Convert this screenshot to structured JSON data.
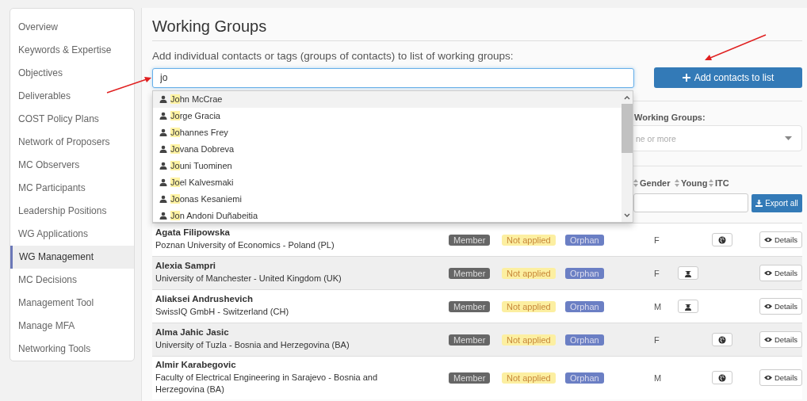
{
  "sidebar": {
    "items": [
      {
        "label": "Overview",
        "selected": false
      },
      {
        "label": "Keywords & Expertise",
        "selected": false
      },
      {
        "label": "Objectives",
        "selected": false
      },
      {
        "label": "Deliverables",
        "selected": false
      },
      {
        "label": "COST Policy Plans",
        "selected": false
      },
      {
        "label": "Network of Proposers",
        "selected": false
      },
      {
        "label": "MC Observers",
        "selected": false
      },
      {
        "label": "MC Participants",
        "selected": false
      },
      {
        "label": "Leadership Positions",
        "selected": false
      },
      {
        "label": "WG Applications",
        "selected": false
      },
      {
        "label": "WG Management",
        "selected": true
      },
      {
        "label": "MC Decisions",
        "selected": false
      },
      {
        "label": "Management Tool",
        "selected": false
      },
      {
        "label": "Manage MFA",
        "selected": false
      },
      {
        "label": "Networking Tools",
        "selected": false
      }
    ]
  },
  "page": {
    "title": "Working Groups",
    "add_label": "Add individual contacts or tags (groups of contacts) to list of working groups:",
    "search": {
      "value": "jo"
    },
    "add_button": "Add contacts to list"
  },
  "suggestions": [
    {
      "match": "Jo",
      "rest": "hn McCrae",
      "selected": true
    },
    {
      "match": "Jo",
      "rest": "rge Gracia",
      "selected": false
    },
    {
      "match": "Jo",
      "rest": "hannes Frey",
      "selected": false
    },
    {
      "match": "Jo",
      "rest": "vana Dobreva",
      "selected": false
    },
    {
      "match": "Jo",
      "rest": "uni Tuominen",
      "selected": false
    },
    {
      "match": "Jo",
      "rest": "el Kalvesmaki",
      "selected": false
    },
    {
      "match": "Jo",
      "rest": "onas Kesaniemi",
      "selected": false
    },
    {
      "match": "Jo",
      "rest": "n Andoni Duñabeitia",
      "selected": false
    }
  ],
  "filter": {
    "label": "Working Groups:",
    "placeholder": "ne or more"
  },
  "table": {
    "columns": [
      "Gender",
      "Young",
      "ITC"
    ],
    "export_button": "Export all",
    "rows": [
      {
        "name": "Agata Filipowska",
        "affiliation": "Poznan University of Economics - Poland (PL)",
        "role": "Member",
        "application": "Not applied",
        "status": "Orphan",
        "gender": "F",
        "young": false,
        "itc": true,
        "details": "Details"
      },
      {
        "name": "Alexia Sampri",
        "affiliation": "University of Manchester - United Kingdom (UK)",
        "role": "Member",
        "application": "Not applied",
        "status": "Orphan",
        "gender": "F",
        "young": true,
        "itc": false,
        "details": "Details"
      },
      {
        "name": "Aliaksei Andrushevich",
        "affiliation": "SwissIQ GmbH - Switzerland (CH)",
        "role": "Member",
        "application": "Not applied",
        "status": "Orphan",
        "gender": "M",
        "young": true,
        "itc": false,
        "details": "Details"
      },
      {
        "name": "Alma Jahic Jasic",
        "affiliation": "University of Tuzla - Bosnia and Herzegovina (BA)",
        "role": "Member",
        "application": "Not applied",
        "status": "Orphan",
        "gender": "F",
        "young": false,
        "itc": true,
        "details": "Details"
      },
      {
        "name": "Almir Karabegovic",
        "affiliation": "Faculty of Electrical Engineering in Sarajevo - Bosnia and Herzegovina (BA)",
        "role": "Member",
        "application": "Not applied",
        "status": "Orphan",
        "gender": "M",
        "young": false,
        "itc": true,
        "details": "Details"
      }
    ]
  }
}
